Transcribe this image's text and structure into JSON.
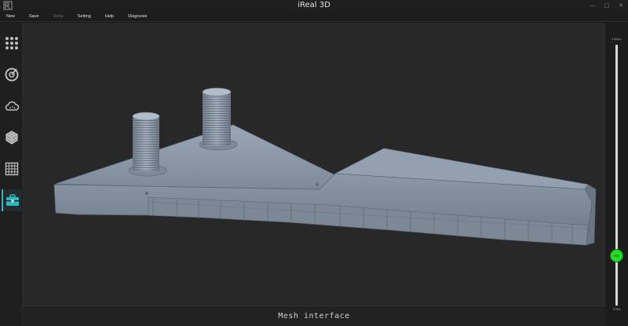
{
  "window": {
    "title": "iReal 3D",
    "controls": [
      "—",
      "□",
      "✕"
    ]
  },
  "menu": [
    {
      "label": "New",
      "enabled": true
    },
    {
      "label": "Save",
      "enabled": true
    },
    {
      "label": "Done",
      "enabled": false
    },
    {
      "label": "Setting",
      "enabled": true
    },
    {
      "label": "Help",
      "enabled": true
    },
    {
      "label": "Diagnosis",
      "enabled": true
    }
  ],
  "sidebar": {
    "items": [
      {
        "icon": "grid-dots-icon"
      },
      {
        "icon": "scan-target-icon"
      },
      {
        "icon": "cloud-icon"
      },
      {
        "icon": "cube-grid-icon"
      },
      {
        "icon": "mesh-grid-icon"
      },
      {
        "icon": "toolbox-icon",
        "active": true
      }
    ]
  },
  "colors": {
    "accent": "#2bb8c0",
    "mesh": "#8a97a6",
    "slider_thumb": "#22dd22",
    "viewport_bg": "#282828"
  },
  "status": {
    "text": "Mesh interface"
  },
  "depth_slider": {
    "max_label": "1300m",
    "min_label": "370m",
    "thumb_label": "530",
    "level_fraction": 0.19
  }
}
